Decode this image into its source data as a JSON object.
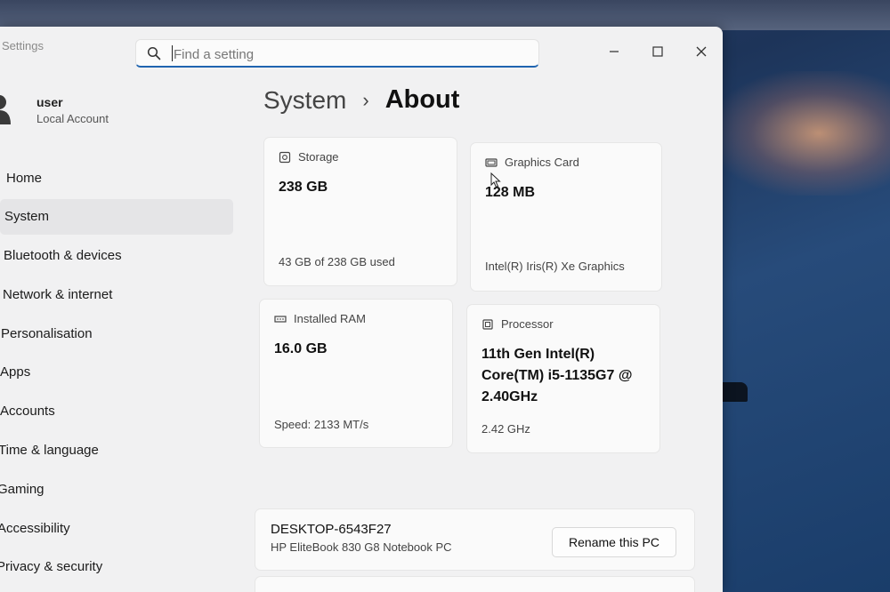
{
  "window": {
    "title": "Settings"
  },
  "search": {
    "placeholder": "Find a setting",
    "value": ""
  },
  "user": {
    "name": "user",
    "account": "Local Account"
  },
  "sidebar": {
    "items": [
      {
        "label": "Home",
        "active": false
      },
      {
        "label": "System",
        "active": true
      },
      {
        "label": "Bluetooth & devices",
        "active": false
      },
      {
        "label": "Network & internet",
        "active": false
      },
      {
        "label": "Personalisation",
        "active": false
      },
      {
        "label": "Apps",
        "active": false
      },
      {
        "label": "Accounts",
        "active": false
      },
      {
        "label": "Time & language",
        "active": false
      },
      {
        "label": "Gaming",
        "active": false
      },
      {
        "label": "Accessibility",
        "active": false
      },
      {
        "label": "Privacy & security",
        "active": false
      }
    ]
  },
  "breadcrumb": {
    "parent": "System",
    "separator": "›",
    "current": "About"
  },
  "specs": {
    "storage": {
      "label": "Storage",
      "value": "238 GB",
      "detail": "43 GB of 238 GB used",
      "icon": "storage-icon"
    },
    "graphics": {
      "label": "Graphics Card",
      "value": "128 MB",
      "detail": "Intel(R) Iris(R) Xe Graphics",
      "icon": "graphics-card-icon"
    },
    "ram": {
      "label": "Installed RAM",
      "value": "16.0 GB",
      "detail": "Speed: 2133 MT/s",
      "icon": "ram-icon"
    },
    "processor": {
      "label": "Processor",
      "value": "11th Gen Intel(R) Core(TM) i5-1135G7 @ 2.40GHz",
      "detail": "2.42 GHz",
      "icon": "processor-icon"
    }
  },
  "device": {
    "name": "DESKTOP-6543F27",
    "model": "HP EliteBook 830 G8 Notebook PC",
    "rename_label": "Rename this PC"
  },
  "colors": {
    "accent": "#1f64b0",
    "window_bg": "#f1f1f2",
    "card_bg": "#fafafa",
    "selected_nav": "#e5e5e7"
  }
}
